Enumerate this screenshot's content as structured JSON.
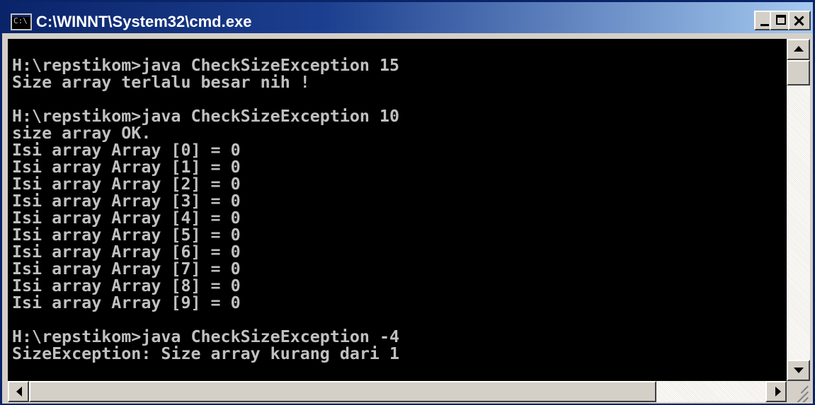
{
  "window": {
    "title": "C:\\WINNT\\System32\\cmd.exe",
    "icon": "cmd-icon",
    "icon_glyph": "C:\\",
    "buttons": {
      "minimize_icon": "minimize-icon",
      "maximize_icon": "maximize-icon",
      "close_icon": "close-icon"
    }
  },
  "console": {
    "background": "#000000",
    "foreground": "#c0c0c0",
    "lines": [
      "H:\\repstikom>java CheckSizeException 15",
      "Size array terlalu besar nih !",
      "",
      "H:\\repstikom>java CheckSizeException 10",
      "size array OK.",
      "Isi array Array [0] = 0",
      "Isi array Array [1] = 0",
      "Isi array Array [2] = 0",
      "Isi array Array [3] = 0",
      "Isi array Array [4] = 0",
      "Isi array Array [5] = 0",
      "Isi array Array [6] = 0",
      "Isi array Array [7] = 0",
      "Isi array Array [8] = 0",
      "Isi array Array [9] = 0",
      "",
      "H:\\repstikom>java CheckSizeException -4",
      "SizeException: Size array kurang dari 1"
    ]
  },
  "scrollbars": {
    "vertical": {
      "up_icon": "arrow-up-icon",
      "down_icon": "arrow-down-icon"
    },
    "horizontal": {
      "left_icon": "arrow-left-icon",
      "right_icon": "arrow-right-icon"
    }
  }
}
